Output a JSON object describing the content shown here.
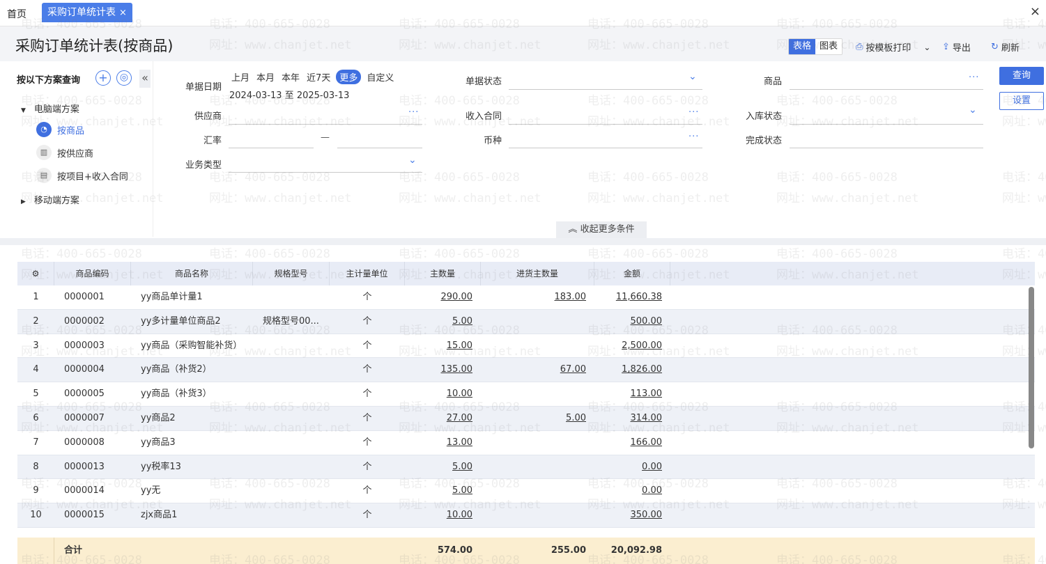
{
  "tabs": {
    "home": "首页",
    "active": "采购订单统计表",
    "close": "×"
  },
  "window_close": "×",
  "header": {
    "title": "采购订单统计表(按商品)",
    "view_table": "表格",
    "view_chart": "图表",
    "print": "按模板打印",
    "print_more": "⌄",
    "export": "导出",
    "refresh": "刷新"
  },
  "scheme_panel": {
    "title": "按以下方案查询",
    "add": "+",
    "target": "◎",
    "collapse": "«",
    "pc_group": "电脑端方案",
    "items": [
      {
        "label": "按商品",
        "icon": "◔"
      },
      {
        "label": "按供应商",
        "icon": "▥"
      },
      {
        "label": "按项目+收入合同",
        "icon": "▤"
      }
    ],
    "mobile_group": "移动端方案"
  },
  "filters": {
    "doc_date_label": "单据日期",
    "quick_dates": [
      "上月",
      "本月",
      "本年",
      "近7天",
      "更多",
      "自定义"
    ],
    "date_range": "2024-03-13 至 2025-03-13",
    "doc_status_label": "单据状态",
    "product_label": "商品",
    "supplier_label": "供应商",
    "income_contract_label": "收入合同",
    "stock_status_label": "入库状态",
    "rate_label": "汇率",
    "rate_sep": "—",
    "currency_label": "币种",
    "complete_status_label": "完成状态",
    "biz_type_label": "业务类型",
    "query": "查询",
    "settings": "设置",
    "fold": "收起更多条件",
    "fold_icon": "︽"
  },
  "table": {
    "settings_icon": "⚙",
    "columns": [
      "商品编码",
      "商品名称",
      "规格型号",
      "主计量单位",
      "主数量",
      "进货主数量",
      "金额"
    ],
    "rows": [
      {
        "no": "1",
        "code": "0000001",
        "name": "yy商品单计量1",
        "spec": "",
        "unit": "个",
        "qty": "290.00",
        "in_qty": "183.00",
        "amount": "11,660.38"
      },
      {
        "no": "2",
        "code": "0000002",
        "name": "yy多计量单位商品2",
        "spec": "规格型号00...",
        "unit": "个",
        "qty": "5.00",
        "in_qty": "",
        "amount": "500.00"
      },
      {
        "no": "3",
        "code": "0000003",
        "name": "yy商品（采购智能补货）",
        "spec": "",
        "unit": "个",
        "qty": "15.00",
        "in_qty": "",
        "amount": "2,500.00"
      },
      {
        "no": "4",
        "code": "0000004",
        "name": "yy商品（补货2）",
        "spec": "",
        "unit": "个",
        "qty": "135.00",
        "in_qty": "67.00",
        "amount": "1,826.00"
      },
      {
        "no": "5",
        "code": "0000005",
        "name": "yy商品（补货3）",
        "spec": "",
        "unit": "个",
        "qty": "10.00",
        "in_qty": "",
        "amount": "113.00"
      },
      {
        "no": "6",
        "code": "0000007",
        "name": "yy商品2",
        "spec": "",
        "unit": "个",
        "qty": "27.00",
        "in_qty": "5.00",
        "amount": "314.00"
      },
      {
        "no": "7",
        "code": "0000008",
        "name": "yy商品3",
        "spec": "",
        "unit": "个",
        "qty": "13.00",
        "in_qty": "",
        "amount": "166.00"
      },
      {
        "no": "8",
        "code": "0000013",
        "name": "yy税率13",
        "spec": "",
        "unit": "个",
        "qty": "5.00",
        "in_qty": "",
        "amount": "0.00"
      },
      {
        "no": "9",
        "code": "0000014",
        "name": "yy无",
        "spec": "",
        "unit": "个",
        "qty": "5.00",
        "in_qty": "",
        "amount": "0.00"
      },
      {
        "no": "10",
        "code": "0000015",
        "name": "zjx商品1",
        "spec": "",
        "unit": "个",
        "qty": "10.00",
        "in_qty": "",
        "amount": "350.00"
      }
    ],
    "total": {
      "label": "合计",
      "qty": "574.00",
      "in_qty": "255.00",
      "amount": "20,092.98"
    }
  },
  "watermark": {
    "phone": "电话：400-665-0028",
    "site": "网址：www.chanjet.net"
  }
}
